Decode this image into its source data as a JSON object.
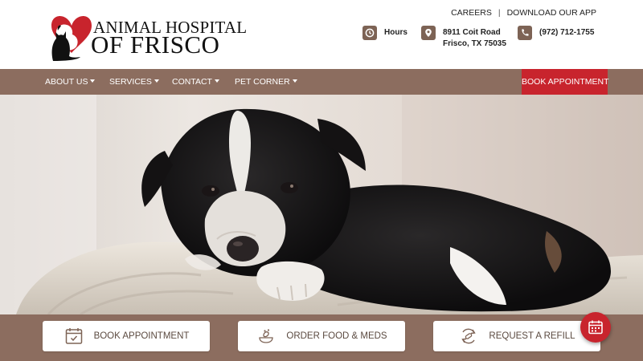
{
  "logo": {
    "line1": "ANIMAL HOSPITAL",
    "line2": "OF FRISCO"
  },
  "top_links": {
    "careers": "CAREERS",
    "separator": "|",
    "download_app": "DOWNLOAD OUR APP"
  },
  "contact": {
    "hours": "Hours",
    "address_line1": "8911 Coit Road",
    "address_line2": "Frisco, TX 75035",
    "phone": "(972) 712-1755"
  },
  "nav": {
    "items": [
      {
        "label": "ABOUT US"
      },
      {
        "label": "SERVICES"
      },
      {
        "label": "CONTACT"
      },
      {
        "label": "PET CORNER"
      }
    ],
    "book_appointment": "BOOK APPOINTMENT"
  },
  "quick_actions": [
    {
      "label": "BOOK APPOINTMENT",
      "icon": "calendar-check-icon"
    },
    {
      "label": "ORDER FOOD & MEDS",
      "icon": "pet-food-icon"
    },
    {
      "label": "REQUEST A REFILL",
      "icon": "refill-pill-icon"
    }
  ],
  "colors": {
    "brand_brown": "#8c6d5f",
    "accent_red": "#c8242d",
    "icon_brown": "#7d6355",
    "heart_red": "#c8242d"
  }
}
